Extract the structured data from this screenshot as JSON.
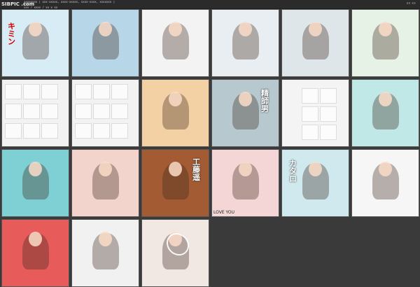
{
  "app": {
    "logo_text": "SIBPIC .com",
    "header_lines": [
      "xxxxxxxx [ xxx-xxxxx, xxxx-xxxxx, xxxx-xxxx, xxxxxxx ]",
      "xxx,",
      "xxx / xxxx / xx x xx"
    ],
    "right_tag": "xx xx"
  },
  "thumbnails": [
    {
      "caption": "",
      "accent": "#d8ecf6"
    },
    {
      "caption": "",
      "accent": "#b7d6e8"
    },
    {
      "caption": "",
      "accent": "#f3f3f3"
    },
    {
      "caption": "",
      "accent": "#e9eef2"
    },
    {
      "caption": "",
      "accent": "#dfe6ea"
    },
    {
      "caption": "",
      "accent": "#e7f2e7"
    },
    {
      "caption": "",
      "accent": "#f2f2f2"
    },
    {
      "caption": "",
      "accent": "#f2f2f2"
    },
    {
      "caption": "",
      "accent": "#f4d1a4"
    },
    {
      "caption": "",
      "accent": "#b7c9cf"
    },
    {
      "caption": "",
      "accent": "#f4f4f4"
    },
    {
      "caption": "",
      "accent": "#bfe8e6"
    },
    {
      "caption": "",
      "accent": "#7fd0d5"
    },
    {
      "caption": "",
      "accent": "#f3d4cc"
    },
    {
      "caption": "",
      "accent": "#a35b33"
    },
    {
      "caption": "LOVE YOU",
      "accent": "#f5d6d6"
    },
    {
      "caption": "",
      "accent": "#cfe9ef"
    },
    {
      "caption": "",
      "accent": "#f6f6f6"
    },
    {
      "caption": "",
      "accent": "#e85b5b"
    },
    {
      "caption": "",
      "accent": "#f1f1f1"
    },
    {
      "caption": "",
      "accent": "#f1e7e3"
    }
  ]
}
